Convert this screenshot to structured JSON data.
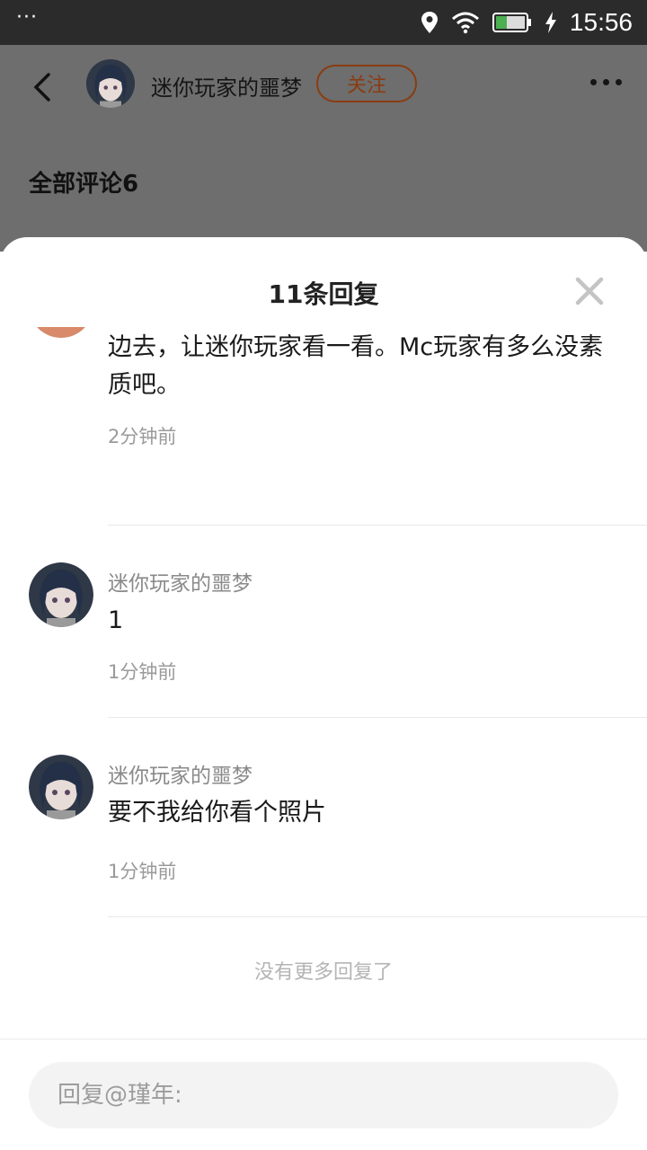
{
  "status_bar": {
    "menu_dots": "···",
    "time": "15:56",
    "icons": [
      "location-icon",
      "wifi-icon",
      "battery-icon",
      "charging-icon"
    ]
  },
  "header": {
    "author": "迷你玩家的噩梦",
    "follow_label": "关注",
    "all_comments_label": "全部评论6"
  },
  "sheet": {
    "title": "11条回复",
    "replies": [
      {
        "name": "",
        "content": "有本事你就使劲骂，使劲骂，然后我发到迷你那边去，让迷你玩家看一看。Mc玩家有多么没素质吧。",
        "time": "2分钟前"
      },
      {
        "name": "迷你玩家的噩梦",
        "content": "1",
        "time": "1分钟前"
      },
      {
        "name": "迷你玩家的噩梦",
        "content": "要不我给你看个照片",
        "time": "1分钟前"
      }
    ],
    "no_more": "没有更多回复了",
    "input_placeholder": "回复@瑾年:"
  },
  "colors": {
    "status_bar": "#2b2b2b",
    "dim_overlay": "#6e6e6e",
    "follow_accent": "#8a3c12",
    "battery_fill": "#4caf50"
  }
}
